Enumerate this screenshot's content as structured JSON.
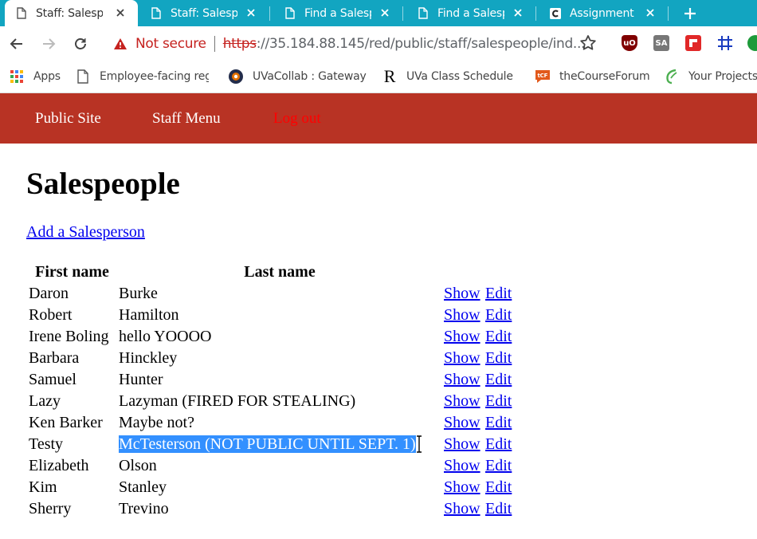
{
  "browser": {
    "tabs": [
      {
        "title": "Staff: Salespeople",
        "active": true,
        "icon": "document-icon"
      },
      {
        "title": "Staff: Salespeople",
        "active": false,
        "icon": "document-icon"
      },
      {
        "title": "Find a Salesperson",
        "active": false,
        "icon": "document-icon"
      },
      {
        "title": "Find a Salesperson",
        "active": false,
        "icon": "document-icon"
      },
      {
        "title": "Assignment",
        "active": false,
        "icon": "c-favicon"
      }
    ],
    "security_label": "Not secure",
    "url_scheme": "https",
    "url_rest": "://35.184.88.145/red/public/staff/salespeople/ind...",
    "accent_color": "#12a5c1"
  },
  "bookmarks": [
    {
      "label": "Apps",
      "icon": "apps-grid-icon"
    },
    {
      "label": "Employee-facing reg",
      "icon": "document-icon"
    },
    {
      "label": "UVaCollab : Gateway",
      "icon": "uvacollab-icon"
    },
    {
      "label": "UVa Class Schedule f",
      "icon": "r-icon"
    },
    {
      "label": "theCourseForum",
      "icon": "tcf-icon"
    },
    {
      "label": "Your Projects",
      "icon": "leaf-icon"
    }
  ],
  "site_nav": {
    "public_site": "Public Site",
    "staff_menu": "Staff Menu",
    "log_out": "Log out",
    "header_color": "#b83324"
  },
  "page": {
    "title": "Salespeople",
    "add_link": "Add a Salesperson",
    "columns": {
      "first_name": "First name",
      "last_name": "Last name"
    },
    "action_show": "Show",
    "action_edit": "Edit",
    "rows": [
      {
        "first": "Daron",
        "last": "Burke"
      },
      {
        "first": "Robert",
        "last": "Hamilton"
      },
      {
        "first": "Irene Boling",
        "last": "hello YOOOO"
      },
      {
        "first": "Barbara",
        "last": "Hinckley"
      },
      {
        "first": "Samuel",
        "last": "Hunter"
      },
      {
        "first": "Lazy",
        "last": "Lazyman (FIRED FOR STEALING)"
      },
      {
        "first": "Ken Barker",
        "last": "Maybe not?"
      },
      {
        "first": "Testy",
        "last": "McTesterson (NOT PUBLIC UNTIL SEPT. 1)",
        "selected": true
      },
      {
        "first": "Elizabeth",
        "last": "Olson"
      },
      {
        "first": "Kim",
        "last": "Stanley"
      },
      {
        "first": "Sherry",
        "last": "Trevino"
      }
    ]
  }
}
